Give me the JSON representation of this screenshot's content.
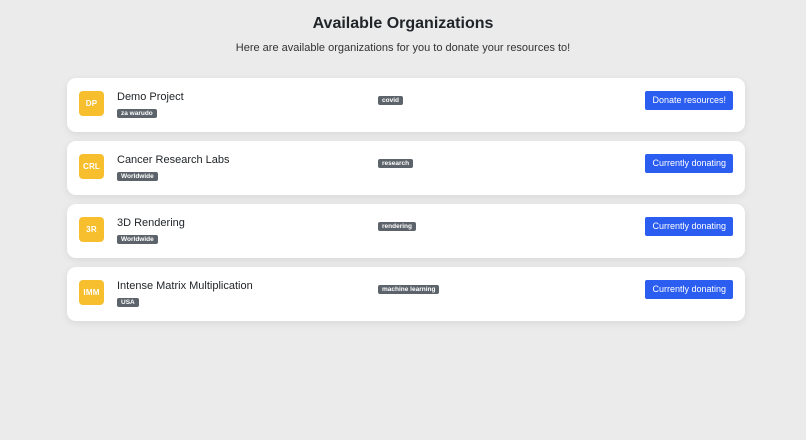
{
  "header": {
    "title": "Available Organizations",
    "subtitle": "Here are available organizations for you to donate your resources to!"
  },
  "colors": {
    "page_background": "#ebebeb",
    "avatar": "#f7be2d",
    "badge": "#5c636a",
    "button": "#2b5ef0"
  },
  "organizations": [
    {
      "initials": "DP",
      "name": "Demo Project",
      "region": "za warudo",
      "tag": "covid",
      "action_label": "Donate resources!"
    },
    {
      "initials": "CRL",
      "name": "Cancer Research Labs",
      "region": "Worldwide",
      "tag": "research",
      "action_label": "Currently donating"
    },
    {
      "initials": "3R",
      "name": "3D Rendering",
      "region": "Worldwide",
      "tag": "rendering",
      "action_label": "Currently donating"
    },
    {
      "initials": "IMM",
      "name": "Intense Matrix Multiplication",
      "region": "USA",
      "tag": "machine learning",
      "action_label": "Currently donating"
    }
  ]
}
